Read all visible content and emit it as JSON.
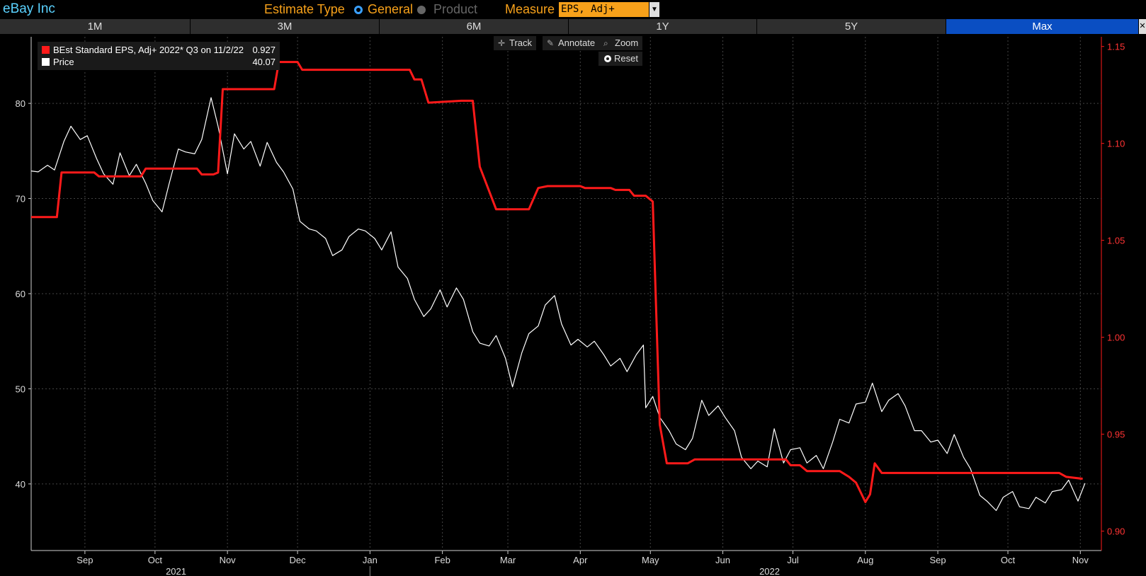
{
  "header": {
    "title": "eBay Inc",
    "estimate_type_label": "Estimate Type",
    "options": [
      "General",
      "Product"
    ],
    "selected_option": "General",
    "measure_label": "Measure",
    "measure_value": "EPS, Adj+"
  },
  "tabs": [
    "1M",
    "3M",
    "6M",
    "1Y",
    "5Y",
    "Max"
  ],
  "active_tab": "Max",
  "tools": {
    "track": "Track",
    "annotate": "Annotate",
    "zoom": "Zoom",
    "reset": "Reset"
  },
  "legend": {
    "eps_label": "BEst Standard EPS, Adj+ 2022* Q3 on 11/2/22",
    "eps_value": "0.927",
    "price_label": "Price",
    "price_value": "40.07"
  },
  "colors": {
    "eps": "#ff1a1a",
    "price": "#ffffff",
    "accent": "#f7a11a",
    "title": "#5ad2ff",
    "active_tab": "#0a4ec2"
  },
  "chart_data": {
    "type": "line",
    "x_start": "2021-08-09",
    "x_end": "2022-11-10",
    "x_ticks": [
      {
        "date": "2021-09-01",
        "label": "Sep"
      },
      {
        "date": "2021-10-01",
        "label": "Oct"
      },
      {
        "date": "2021-11-01",
        "label": "Nov"
      },
      {
        "date": "2021-12-01",
        "label": "Dec"
      },
      {
        "date": "2022-01-01",
        "label": "Jan"
      },
      {
        "date": "2022-02-01",
        "label": "Feb"
      },
      {
        "date": "2022-03-01",
        "label": "Mar"
      },
      {
        "date": "2022-04-01",
        "label": "Apr"
      },
      {
        "date": "2022-05-01",
        "label": "May"
      },
      {
        "date": "2022-06-01",
        "label": "Jun"
      },
      {
        "date": "2022-07-01",
        "label": "Jul"
      },
      {
        "date": "2022-08-01",
        "label": "Aug"
      },
      {
        "date": "2022-09-01",
        "label": "Sep"
      },
      {
        "date": "2022-10-01",
        "label": "Oct"
      },
      {
        "date": "2022-11-01",
        "label": "Nov"
      }
    ],
    "year_labels": [
      {
        "date": "2021-10-10",
        "label": "2021"
      },
      {
        "date": "2022-06-21",
        "label": "2022"
      }
    ],
    "left_axis": {
      "ylim": [
        33,
        87
      ],
      "ticks": [
        40,
        50,
        60,
        70,
        80
      ]
    },
    "right_axis": {
      "ylim": [
        0.89,
        1.155
      ],
      "ticks": [
        "0.90",
        "0.95",
        "1.00",
        "1.05",
        "1.10",
        "1.15"
      ]
    },
    "series": [
      {
        "name": "Price",
        "axis": "left",
        "color": "#ffffff",
        "points": [
          [
            "2021-08-09",
            72.9
          ],
          [
            "2021-08-12",
            72.8
          ],
          [
            "2021-08-16",
            73.5
          ],
          [
            "2021-08-19",
            73.0
          ],
          [
            "2021-08-23",
            76.0
          ],
          [
            "2021-08-26",
            77.6
          ],
          [
            "2021-08-30",
            76.2
          ],
          [
            "2021-09-02",
            76.6
          ],
          [
            "2021-09-06",
            74.2
          ],
          [
            "2021-09-09",
            72.6
          ],
          [
            "2021-09-13",
            71.5
          ],
          [
            "2021-09-16",
            74.8
          ],
          [
            "2021-09-20",
            72.4
          ],
          [
            "2021-09-23",
            73.6
          ],
          [
            "2021-09-27",
            71.6
          ],
          [
            "2021-09-30",
            69.8
          ],
          [
            "2021-10-04",
            68.6
          ],
          [
            "2021-10-07",
            71.5
          ],
          [
            "2021-10-11",
            75.2
          ],
          [
            "2021-10-14",
            74.9
          ],
          [
            "2021-10-18",
            74.7
          ],
          [
            "2021-10-21",
            76.2
          ],
          [
            "2021-10-25",
            80.6
          ],
          [
            "2021-10-28",
            77.6
          ],
          [
            "2021-11-01",
            72.6
          ],
          [
            "2021-11-04",
            76.8
          ],
          [
            "2021-11-08",
            75.2
          ],
          [
            "2021-11-11",
            76.0
          ],
          [
            "2021-11-15",
            73.4
          ],
          [
            "2021-11-18",
            75.9
          ],
          [
            "2021-11-22",
            73.8
          ],
          [
            "2021-11-25",
            72.8
          ],
          [
            "2021-11-29",
            71.0
          ],
          [
            "2021-12-02",
            67.6
          ],
          [
            "2021-12-06",
            66.8
          ],
          [
            "2021-12-09",
            66.6
          ],
          [
            "2021-12-13",
            65.8
          ],
          [
            "2021-12-16",
            64.0
          ],
          [
            "2021-12-20",
            64.6
          ],
          [
            "2021-12-23",
            66.0
          ],
          [
            "2021-12-27",
            66.8
          ],
          [
            "2021-12-30",
            66.6
          ],
          [
            "2022-01-03",
            65.8
          ],
          [
            "2022-01-06",
            64.6
          ],
          [
            "2022-01-10",
            66.5
          ],
          [
            "2022-01-13",
            62.8
          ],
          [
            "2022-01-17",
            61.6
          ],
          [
            "2022-01-20",
            59.4
          ],
          [
            "2022-01-24",
            57.6
          ],
          [
            "2022-01-27",
            58.4
          ],
          [
            "2022-01-31",
            60.4
          ],
          [
            "2022-02-03",
            58.6
          ],
          [
            "2022-02-07",
            60.6
          ],
          [
            "2022-02-10",
            59.4
          ],
          [
            "2022-02-14",
            56.0
          ],
          [
            "2022-02-17",
            54.8
          ],
          [
            "2022-02-21",
            54.5
          ],
          [
            "2022-02-24",
            55.6
          ],
          [
            "2022-02-28",
            53.2
          ],
          [
            "2022-03-03",
            50.2
          ],
          [
            "2022-03-07",
            53.8
          ],
          [
            "2022-03-10",
            55.8
          ],
          [
            "2022-03-14",
            56.6
          ],
          [
            "2022-03-17",
            58.8
          ],
          [
            "2022-03-21",
            59.8
          ],
          [
            "2022-03-24",
            56.8
          ],
          [
            "2022-03-28",
            54.6
          ],
          [
            "2022-03-31",
            55.2
          ],
          [
            "2022-04-04",
            54.4
          ],
          [
            "2022-04-07",
            55.0
          ],
          [
            "2022-04-11",
            53.6
          ],
          [
            "2022-04-14",
            52.4
          ],
          [
            "2022-04-18",
            53.2
          ],
          [
            "2022-04-21",
            51.8
          ],
          [
            "2022-04-25",
            53.6
          ],
          [
            "2022-04-28",
            54.6
          ],
          [
            "2022-04-29",
            48.0
          ],
          [
            "2022-05-02",
            49.2
          ],
          [
            "2022-05-05",
            47.0
          ],
          [
            "2022-05-09",
            45.6
          ],
          [
            "2022-05-12",
            44.2
          ],
          [
            "2022-05-16",
            43.6
          ],
          [
            "2022-05-19",
            44.8
          ],
          [
            "2022-05-23",
            48.8
          ],
          [
            "2022-05-26",
            47.2
          ],
          [
            "2022-05-30",
            48.2
          ],
          [
            "2022-06-02",
            47.0
          ],
          [
            "2022-06-06",
            45.6
          ],
          [
            "2022-06-09",
            42.8
          ],
          [
            "2022-06-13",
            41.6
          ],
          [
            "2022-06-16",
            42.4
          ],
          [
            "2022-06-20",
            41.8
          ],
          [
            "2022-06-23",
            45.8
          ],
          [
            "2022-06-27",
            42.2
          ],
          [
            "2022-06-30",
            43.6
          ],
          [
            "2022-07-04",
            43.8
          ],
          [
            "2022-07-07",
            42.2
          ],
          [
            "2022-07-11",
            43.0
          ],
          [
            "2022-07-14",
            41.6
          ],
          [
            "2022-07-18",
            44.4
          ],
          [
            "2022-07-21",
            46.8
          ],
          [
            "2022-07-25",
            46.4
          ],
          [
            "2022-07-28",
            48.4
          ],
          [
            "2022-08-01",
            48.6
          ],
          [
            "2022-08-04",
            50.6
          ],
          [
            "2022-08-08",
            47.6
          ],
          [
            "2022-08-11",
            48.8
          ],
          [
            "2022-08-15",
            49.5
          ],
          [
            "2022-08-18",
            48.2
          ],
          [
            "2022-08-22",
            45.6
          ],
          [
            "2022-08-25",
            45.6
          ],
          [
            "2022-08-29",
            44.4
          ],
          [
            "2022-09-01",
            44.6
          ],
          [
            "2022-09-05",
            43.2
          ],
          [
            "2022-09-08",
            45.2
          ],
          [
            "2022-09-12",
            42.8
          ],
          [
            "2022-09-15",
            41.6
          ],
          [
            "2022-09-19",
            38.8
          ],
          [
            "2022-09-22",
            38.2
          ],
          [
            "2022-09-26",
            37.2
          ],
          [
            "2022-09-29",
            38.6
          ],
          [
            "2022-10-03",
            39.2
          ],
          [
            "2022-10-06",
            37.6
          ],
          [
            "2022-10-10",
            37.4
          ],
          [
            "2022-10-13",
            38.6
          ],
          [
            "2022-10-17",
            38.0
          ],
          [
            "2022-10-20",
            39.2
          ],
          [
            "2022-10-24",
            39.4
          ],
          [
            "2022-10-27",
            40.4
          ],
          [
            "2022-10-31",
            38.2
          ],
          [
            "2022-11-03",
            40.07
          ]
        ]
      },
      {
        "name": "BEst Standard EPS, Adj+ 2022* Q3",
        "axis": "right",
        "color": "#ff1a1a",
        "step": true,
        "points": [
          [
            "2021-08-09",
            1.062
          ],
          [
            "2021-08-20",
            1.062
          ],
          [
            "2021-08-22",
            1.085
          ],
          [
            "2021-09-05",
            1.085
          ],
          [
            "2021-09-07",
            1.083
          ],
          [
            "2021-09-25",
            1.083
          ],
          [
            "2021-09-27",
            1.087
          ],
          [
            "2021-10-19",
            1.087
          ],
          [
            "2021-10-21",
            1.084
          ],
          [
            "2021-10-26",
            1.084
          ],
          [
            "2021-10-28",
            1.085
          ],
          [
            "2021-10-30",
            1.128
          ],
          [
            "2021-11-21",
            1.128
          ],
          [
            "2021-11-23",
            1.142
          ],
          [
            "2021-12-01",
            1.142
          ],
          [
            "2021-12-03",
            1.138
          ],
          [
            "2022-01-18",
            1.138
          ],
          [
            "2022-01-20",
            1.133
          ],
          [
            "2022-01-23",
            1.133
          ],
          [
            "2022-01-26",
            1.121
          ],
          [
            "2022-02-09",
            1.122
          ],
          [
            "2022-02-14",
            1.122
          ],
          [
            "2022-02-17",
            1.088
          ],
          [
            "2022-02-24",
            1.066
          ],
          [
            "2022-03-10",
            1.066
          ],
          [
            "2022-03-14",
            1.077
          ],
          [
            "2022-03-18",
            1.078
          ],
          [
            "2022-04-01",
            1.078
          ],
          [
            "2022-04-03",
            1.077
          ],
          [
            "2022-04-14",
            1.077
          ],
          [
            "2022-04-16",
            1.076
          ],
          [
            "2022-04-22",
            1.076
          ],
          [
            "2022-04-24",
            1.073
          ],
          [
            "2022-04-29",
            1.073
          ],
          [
            "2022-05-02",
            1.07
          ],
          [
            "2022-05-05",
            0.955
          ],
          [
            "2022-05-08",
            0.935
          ],
          [
            "2022-05-17",
            0.935
          ],
          [
            "2022-05-20",
            0.937
          ],
          [
            "2022-06-28",
            0.937
          ],
          [
            "2022-06-30",
            0.934
          ],
          [
            "2022-07-04",
            0.934
          ],
          [
            "2022-07-07",
            0.931
          ],
          [
            "2022-07-21",
            0.931
          ],
          [
            "2022-07-25",
            0.928
          ],
          [
            "2022-07-28",
            0.925
          ],
          [
            "2022-08-01",
            0.915
          ],
          [
            "2022-08-03",
            0.919
          ],
          [
            "2022-08-05",
            0.935
          ],
          [
            "2022-08-08",
            0.93
          ],
          [
            "2022-10-23",
            0.93
          ],
          [
            "2022-10-26",
            0.928
          ],
          [
            "2022-11-02",
            0.927
          ]
        ]
      }
    ]
  }
}
